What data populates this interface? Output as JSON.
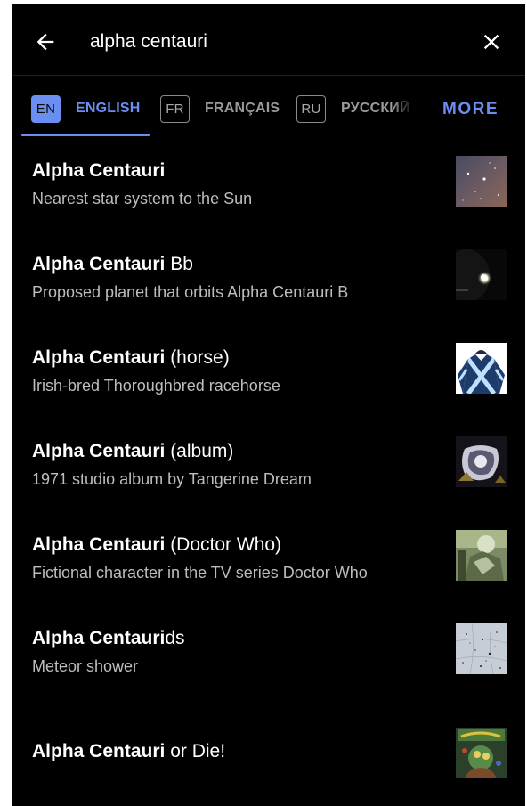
{
  "search": {
    "query": "alpha centauri"
  },
  "icons": {
    "back": "arrow-left-icon",
    "clear": "close-icon"
  },
  "languages": [
    {
      "code": "EN",
      "name": "ENGLISH",
      "active": true
    },
    {
      "code": "FR",
      "name": "FRANÇAIS",
      "active": false
    },
    {
      "code": "RU",
      "name": "РУССКИЙ",
      "active": false
    }
  ],
  "more_label": "MORE",
  "colors": {
    "accent": "#6b8ef2",
    "background": "#000000",
    "secondary_text": "#bdbdbd"
  },
  "results": [
    {
      "bold": "Alpha Centauri",
      "rest": "",
      "description": "Nearest star system to the Sun",
      "thumbnail": "star-field-image"
    },
    {
      "bold": "Alpha Centauri",
      "rest": " Bb",
      "description": "Proposed planet that orbits Alpha Centauri B",
      "thumbnail": "planet-image"
    },
    {
      "bold": "Alpha Centauri",
      "rest": " (horse)",
      "description": "Irish-bred Thoroughbred racehorse",
      "thumbnail": "jockey-silks-image"
    },
    {
      "bold": "Alpha Centauri",
      "rest": " (album)",
      "description": "1971 studio album by Tangerine Dream",
      "thumbnail": "album-cover-image"
    },
    {
      "bold": "Alpha Centauri",
      "rest": " (Doctor Who)",
      "description": "Fictional character in the TV series Doctor Who",
      "thumbnail": "tv-character-image"
    },
    {
      "bold": "Alpha Centauri",
      "rest": "ds",
      "description": "Meteor shower",
      "thumbnail": "star-chart-image"
    },
    {
      "bold": "Alpha Centauri",
      "rest": " or Die!",
      "description": "",
      "thumbnail": "comic-cover-image"
    }
  ]
}
